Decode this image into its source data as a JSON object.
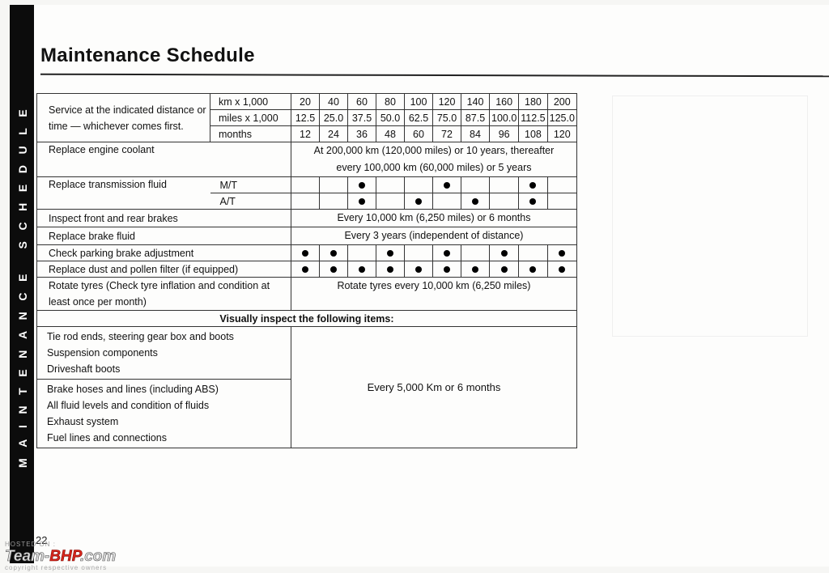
{
  "page": {
    "title": "Maintenance Schedule",
    "side_label": "MAINTENANCE SCHEDULE",
    "page_number": "22"
  },
  "schedule": {
    "intro": "Service at the indicated distance or time — whichever comes first.",
    "units": [
      "km x 1,000",
      "miles x 1,000",
      "months"
    ],
    "km": [
      "20",
      "40",
      "60",
      "80",
      "100",
      "120",
      "140",
      "160",
      "180",
      "200"
    ],
    "miles": [
      "12.5",
      "25.0",
      "37.5",
      "50.0",
      "62.5",
      "75.0",
      "87.5",
      "100.0",
      "112.5",
      "125.0"
    ],
    "months": [
      "12",
      "24",
      "36",
      "48",
      "60",
      "72",
      "84",
      "96",
      "108",
      "120"
    ],
    "items": {
      "coolant": {
        "label": "Replace engine coolant",
        "value": "At 200,000 km (120,000 miles) or 10 years, thereafter every 100,000 km (60,000 miles) or 5 years"
      },
      "transmission": {
        "label": "Replace transmission fluid",
        "mt_label": "M/T",
        "at_label": "A/T",
        "mt_marks": [
          false,
          false,
          true,
          false,
          false,
          true,
          false,
          false,
          true,
          false
        ],
        "at_marks": [
          false,
          false,
          true,
          false,
          true,
          false,
          true,
          false,
          true,
          false
        ]
      },
      "brakes": {
        "label": "Inspect front and rear brakes",
        "value": "Every 10,000 km (6,250 miles) or 6 months"
      },
      "brake_fluid": {
        "label": "Replace brake fluid",
        "value": "Every 3 years (independent of distance)"
      },
      "parking_brake": {
        "label": "Check parking brake adjustment",
        "marks": [
          true,
          true,
          false,
          true,
          false,
          true,
          false,
          true,
          false,
          true
        ]
      },
      "pollen_filter": {
        "label": "Replace dust and pollen filter (if equipped)",
        "marks": [
          true,
          true,
          true,
          true,
          true,
          true,
          true,
          true,
          true,
          true
        ]
      },
      "tyres": {
        "label": "Rotate tyres (Check tyre inflation and condition at least once per month)",
        "value": "Rotate tyres every 10,000 km (6,250 miles)"
      }
    },
    "visual": {
      "heading": "Visually inspect the following items:",
      "group1": [
        "Tie rod ends, steering gear box and boots",
        "Suspension components",
        "Driveshaft boots"
      ],
      "group2": [
        "Brake hoses and lines (including ABS)",
        "All fluid levels and condition of fluids",
        "Exhaust system",
        "Fuel lines and connections"
      ],
      "value": "Every 5,000 Km or 6 months"
    }
  },
  "watermark": {
    "hosted": "HOSTED ON :",
    "brand_a": "Team-",
    "brand_b": "BHP",
    "brand_c": ".com",
    "copyright": "copyright respective owners"
  }
}
